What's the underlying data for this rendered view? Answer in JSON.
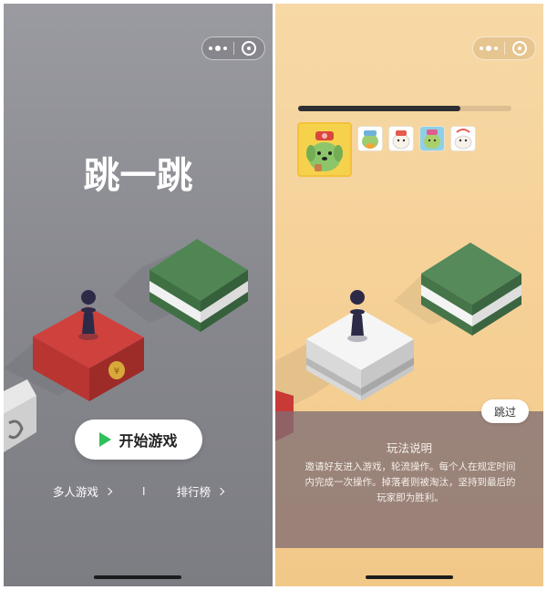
{
  "home": {
    "logo": "跳一跳",
    "start_label": "开始游戏",
    "multiplayer_label": "多人游戏",
    "divider": "I",
    "leaderboard_label": "排行榜",
    "coin_symbol": "¥"
  },
  "tutorial": {
    "progress": 0.76,
    "overlay_title": "玩法说明",
    "overlay_desc": "邀请好友进入游戏，轮流操作。每个人在规定时间内完成一次操作。掉落者则被淘汰，坚持到最后的玩家即为胜利。",
    "skip_label": "跳过"
  },
  "colors": {
    "left_bg": "#8e8f95",
    "right_bg": "#f6d39c",
    "play_green": "#2fbf5b",
    "red_block": "#c93a37",
    "green_block": "#4f8653"
  },
  "icons": [
    "more-dots-icon",
    "close-target-icon",
    "play-icon",
    "chevron-right-icon",
    "coin-icon"
  ]
}
